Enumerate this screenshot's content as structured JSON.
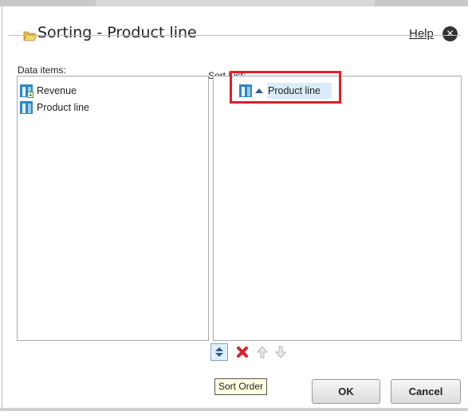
{
  "dialog": {
    "title": "Sorting - Product line",
    "help_label": "Help",
    "close_glyph": "✕"
  },
  "data_items": {
    "label": "Data items:",
    "items": [
      {
        "label": "Revenue",
        "icon": "measure-icon"
      },
      {
        "label": "Product line",
        "icon": "data-item-icon"
      }
    ]
  },
  "sort_list": {
    "label": "Sort List:",
    "items": [
      {
        "label": "Product line",
        "direction": "ascending",
        "icon": "data-item-icon"
      }
    ]
  },
  "toolbar": {
    "sort_order_tooltip": "Sort Order",
    "icons": [
      "sort-order-icon",
      "delete-icon",
      "move-up-icon",
      "move-down-icon"
    ]
  },
  "buttons": {
    "ok": "OK",
    "cancel": "Cancel"
  },
  "colors": {
    "highlight": "#e21d2b",
    "selection": "#d9ecf8",
    "delete": "#d8232a"
  }
}
